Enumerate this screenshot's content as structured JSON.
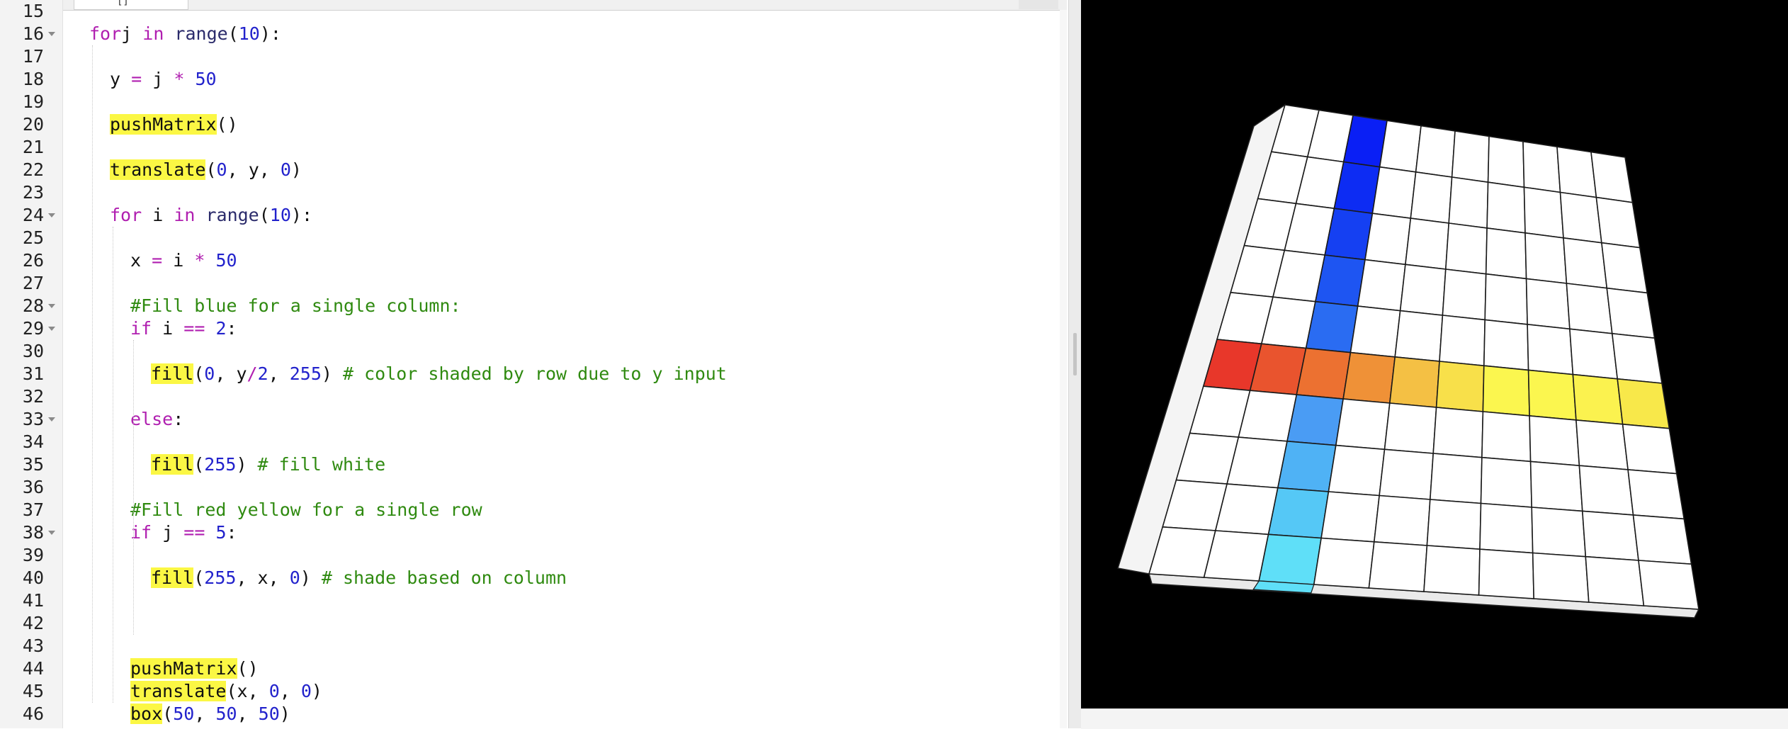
{
  "editor": {
    "tab_label": "[]",
    "lines": [
      {
        "n": "15",
        "fold": false,
        "indent": 0,
        "tokens": []
      },
      {
        "n": "16",
        "fold": true,
        "indent": 0,
        "tokens": [
          [
            "kw",
            "for"
          ],
          [
            "",
            "j "
          ],
          [
            "kw",
            "in"
          ],
          [
            "fn",
            " range"
          ],
          [
            "",
            "("
          ],
          [
            "num",
            "10"
          ],
          [
            "",
            "):"
          ]
        ]
      },
      {
        "n": "17",
        "fold": false,
        "indent": 0,
        "tokens": []
      },
      {
        "n": "18",
        "fold": false,
        "indent": 1,
        "tokens": [
          [
            "",
            "y "
          ],
          [
            "op",
            "="
          ],
          [
            "",
            " j "
          ],
          [
            "op",
            "*"
          ],
          [
            "",
            " "
          ],
          [
            "num",
            "50"
          ]
        ]
      },
      {
        "n": "19",
        "fold": false,
        "indent": 0,
        "tokens": []
      },
      {
        "n": "20",
        "fold": false,
        "indent": 1,
        "tokens": [
          [
            "hl",
            "pushMatrix"
          ],
          [
            "",
            "()"
          ]
        ]
      },
      {
        "n": "21",
        "fold": false,
        "indent": 0,
        "tokens": []
      },
      {
        "n": "22",
        "fold": false,
        "indent": 1,
        "tokens": [
          [
            "hl",
            "translate"
          ],
          [
            "",
            "("
          ],
          [
            "num",
            "0"
          ],
          [
            "",
            ", y, "
          ],
          [
            "num",
            "0"
          ],
          [
            "",
            ")"
          ]
        ]
      },
      {
        "n": "23",
        "fold": false,
        "indent": 0,
        "tokens": []
      },
      {
        "n": "24",
        "fold": true,
        "indent": 1,
        "tokens": [
          [
            "kw",
            "for"
          ],
          [
            "",
            " i "
          ],
          [
            "kw",
            "in"
          ],
          [
            "fn",
            " range"
          ],
          [
            "",
            "("
          ],
          [
            "num",
            "10"
          ],
          [
            "",
            "):"
          ]
        ]
      },
      {
        "n": "25",
        "fold": false,
        "indent": 0,
        "tokens": []
      },
      {
        "n": "26",
        "fold": false,
        "indent": 2,
        "tokens": [
          [
            "",
            "x "
          ],
          [
            "op",
            "="
          ],
          [
            "",
            " i "
          ],
          [
            "op",
            "*"
          ],
          [
            "",
            " "
          ],
          [
            "num",
            "50"
          ]
        ]
      },
      {
        "n": "27",
        "fold": false,
        "indent": 0,
        "tokens": []
      },
      {
        "n": "28",
        "fold": true,
        "indent": 2,
        "tokens": [
          [
            "cm",
            "#Fill blue for a single column:"
          ]
        ]
      },
      {
        "n": "29",
        "fold": true,
        "indent": 2,
        "tokens": [
          [
            "kw",
            "if"
          ],
          [
            "",
            " i "
          ],
          [
            "op",
            "=="
          ],
          [
            "",
            " "
          ],
          [
            "num",
            "2"
          ],
          [
            "",
            ":"
          ]
        ]
      },
      {
        "n": "30",
        "fold": false,
        "indent": 0,
        "tokens": []
      },
      {
        "n": "31",
        "fold": false,
        "indent": 3,
        "tokens": [
          [
            "hl",
            "fill"
          ],
          [
            "",
            "("
          ],
          [
            "num",
            "0"
          ],
          [
            "",
            ", y"
          ],
          [
            "op",
            "/"
          ],
          [
            "num",
            "2"
          ],
          [
            "",
            ", "
          ],
          [
            "num",
            "255"
          ],
          [
            "",
            ") "
          ],
          [
            "cm",
            "# color shaded by row due to y input"
          ]
        ]
      },
      {
        "n": "32",
        "fold": false,
        "indent": 0,
        "tokens": []
      },
      {
        "n": "33",
        "fold": true,
        "indent": 2,
        "tokens": [
          [
            "kw",
            "else"
          ],
          [
            "",
            ":"
          ]
        ]
      },
      {
        "n": "34",
        "fold": false,
        "indent": 0,
        "tokens": []
      },
      {
        "n": "35",
        "fold": false,
        "indent": 3,
        "tokens": [
          [
            "hl",
            "fill"
          ],
          [
            "",
            "("
          ],
          [
            "num",
            "255"
          ],
          [
            "",
            ") "
          ],
          [
            "cm",
            "# fill white"
          ]
        ]
      },
      {
        "n": "36",
        "fold": false,
        "indent": 0,
        "tokens": []
      },
      {
        "n": "37",
        "fold": false,
        "indent": 2,
        "tokens": [
          [
            "cm",
            "#Fill red yellow for a single row"
          ]
        ]
      },
      {
        "n": "38",
        "fold": true,
        "indent": 2,
        "tokens": [
          [
            "kw",
            "if"
          ],
          [
            "",
            " j "
          ],
          [
            "op",
            "=="
          ],
          [
            "",
            " "
          ],
          [
            "num",
            "5"
          ],
          [
            "",
            ":"
          ]
        ]
      },
      {
        "n": "39",
        "fold": false,
        "indent": 0,
        "tokens": []
      },
      {
        "n": "40",
        "fold": false,
        "indent": 3,
        "tokens": [
          [
            "hl",
            "fill"
          ],
          [
            "",
            "("
          ],
          [
            "num",
            "255"
          ],
          [
            "",
            ", x, "
          ],
          [
            "num",
            "0"
          ],
          [
            "",
            ") "
          ],
          [
            "cm",
            "# shade based on column"
          ]
        ]
      },
      {
        "n": "41",
        "fold": false,
        "indent": 0,
        "tokens": []
      },
      {
        "n": "42",
        "fold": false,
        "indent": 0,
        "tokens": []
      },
      {
        "n": "43",
        "fold": false,
        "indent": 0,
        "tokens": []
      },
      {
        "n": "44",
        "fold": false,
        "indent": 2,
        "tokens": [
          [
            "hl",
            "pushMatrix"
          ],
          [
            "",
            "()"
          ]
        ]
      },
      {
        "n": "45",
        "fold": false,
        "indent": 2,
        "tokens": [
          [
            "hl",
            "translate"
          ],
          [
            "",
            "(x, "
          ],
          [
            "num",
            "0"
          ],
          [
            "",
            ", "
          ],
          [
            "num",
            "0"
          ],
          [
            "",
            ")"
          ]
        ]
      },
      {
        "n": "46",
        "fold": false,
        "indent": 2,
        "tokens": [
          [
            "hl",
            "box"
          ],
          [
            "",
            "("
          ],
          [
            "num",
            "50"
          ],
          [
            "",
            ", "
          ],
          [
            "num",
            "50"
          ],
          [
            "",
            ", "
          ],
          [
            "num",
            "50"
          ],
          [
            "",
            ")"
          ]
        ]
      }
    ]
  },
  "sketch": {
    "grid_cols": 10,
    "grid_rows": 10,
    "highlight_column": 2,
    "highlight_row": 5,
    "background_color": "#000000",
    "cell_color": "#ffffff",
    "column_colors": [
      "#0a1ff5",
      "#0d2cf3",
      "#1540f2",
      "#1e55f2",
      "#2a6cf2",
      "#3e86f3",
      "#4a9cf4",
      "#4fb2f5",
      "#55c8f6",
      "#5fdff8"
    ],
    "row_colors": [
      "#e8372a",
      "#e9542e",
      "#ec7131",
      "#ef9137",
      "#f4c044",
      "#f8e04a",
      "#fbf64f",
      "#fbf64f",
      "#fbf24f",
      "#f8e84a"
    ]
  }
}
